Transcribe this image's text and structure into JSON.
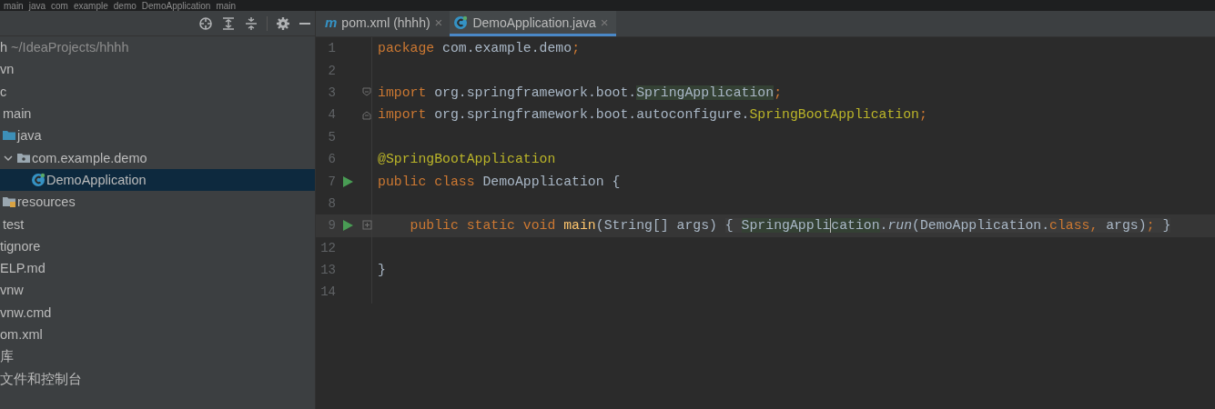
{
  "breadcrumb": [
    "main",
    "java",
    "com",
    "example",
    "demo",
    "DemoApplication",
    "main"
  ],
  "project_tree": [
    {
      "label": "h",
      "path": "~/IdeaProjects/hhhh",
      "children": [
        {
          "label": "vn"
        },
        {
          "label": "c",
          "children": [
            {
              "label": "main",
              "children": [
                {
                  "label": "java",
                  "kind": "source",
                  "children": [
                    {
                      "label": "com.example.demo",
                      "kind": "package",
                      "expanded": true,
                      "children": [
                        {
                          "label": "DemoApplication",
                          "kind": "class",
                          "selected": true
                        }
                      ]
                    }
                  ]
                },
                {
                  "label": "resources",
                  "kind": "resources"
                }
              ]
            },
            {
              "label": "test"
            }
          ]
        },
        {
          "label": "tignore"
        },
        {
          "label": "ELP.md"
        },
        {
          "label": "vnw"
        },
        {
          "label": "vnw.cmd"
        },
        {
          "label": "om.xml"
        }
      ]
    },
    {
      "label": "库"
    },
    {
      "label": "文件和控制台"
    }
  ],
  "tabs": [
    {
      "kind": "maven",
      "badge": "m",
      "label": "pom.xml (hhhh)",
      "close": "×",
      "selected": false
    },
    {
      "kind": "class",
      "label": "DemoApplication.java",
      "close": "×",
      "selected": true
    }
  ],
  "editor": {
    "lines": [
      {
        "number": "1",
        "kind": "plain",
        "run": false,
        "tokens": [
          {
            "kind": "kw",
            "text": "package "
          },
          {
            "kind": "plain",
            "text": "com.example.demo"
          },
          {
            "kind": "kw",
            "text": ";"
          }
        ]
      },
      {
        "number": "2",
        "kind": "plain",
        "run": false
      },
      {
        "number": "3",
        "kind": "foldstart",
        "run": false,
        "tokens": [
          {
            "kind": "kw",
            "text": "import "
          },
          {
            "kind": "plain",
            "text": "org.springframework.boot."
          },
          {
            "kind": "ref",
            "text": "SpringApplication"
          },
          {
            "kind": "kw",
            "text": ";"
          }
        ]
      },
      {
        "number": "4",
        "kind": "foldend",
        "run": false,
        "tokens": [
          {
            "kind": "kw",
            "text": "import "
          },
          {
            "kind": "plain",
            "text": "org.springframework.boot.autoconfigure."
          },
          {
            "kind": "ann",
            "text": "SpringBootApplication"
          },
          {
            "kind": "kw",
            "text": ";"
          }
        ]
      },
      {
        "number": "5",
        "kind": "plain",
        "run": false
      },
      {
        "number": "6",
        "kind": "plain",
        "run": false,
        "tokens": [
          {
            "kind": "ann",
            "text": "@SpringBootApplication"
          }
        ]
      },
      {
        "number": "7",
        "kind": "plain",
        "run": true,
        "tokens": [
          {
            "kind": "kw",
            "text": "public class "
          },
          {
            "kind": "plain",
            "text": "DemoApplication {"
          }
        ]
      },
      {
        "number": "8",
        "kind": "plain",
        "run": false
      },
      {
        "number": "9",
        "kind": "folded",
        "run": true,
        "tokens": [
          {
            "kind": "kw",
            "text": "    public static void "
          },
          {
            "kind": "fn",
            "text": "main"
          },
          {
            "kind": "plain",
            "text": "(String[] args) "
          },
          {
            "kind": "fold",
            "text": "{ "
          },
          {
            "kind": "ref",
            "text": "SpringAppli",
            "caret": true
          },
          {
            "kind": "ref",
            "text": "cation"
          },
          {
            "kind": "fold-plain",
            "text": "."
          },
          {
            "kind": "static",
            "text": "run"
          },
          {
            "kind": "fold-plain",
            "text": "(DemoApplication."
          },
          {
            "kind": "fold-kw",
            "text": "class, "
          },
          {
            "kind": "fold-plain",
            "text": "args)"
          },
          {
            "kind": "fold-kw",
            "text": ";"
          },
          {
            "kind": "fold",
            "text": " }"
          }
        ]
      },
      {
        "number": "12",
        "kind": "plain",
        "run": false
      },
      {
        "number": "13",
        "kind": "plain",
        "run": false,
        "tokens": [
          {
            "kind": "plain",
            "text": "}"
          }
        ]
      },
      {
        "number": "14",
        "kind": "plain",
        "run": false
      }
    ]
  }
}
